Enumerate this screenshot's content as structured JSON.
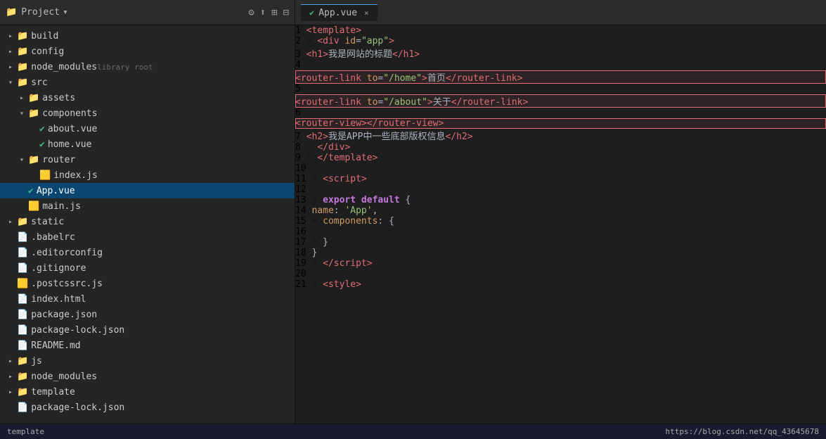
{
  "topbar": {
    "project_label": "Project",
    "dropdown_icon": "▾",
    "tab_label": "App.vue",
    "tab_close": "×"
  },
  "filetree": {
    "items": [
      {
        "id": "build",
        "label": "build",
        "type": "folder",
        "indent": 0,
        "open": false
      },
      {
        "id": "config",
        "label": "config",
        "type": "folder",
        "indent": 0,
        "open": false
      },
      {
        "id": "node_modules",
        "label": "node_modules",
        "suffix": "library root",
        "type": "folder",
        "indent": 0,
        "open": false
      },
      {
        "id": "src",
        "label": "src",
        "type": "folder",
        "indent": 0,
        "open": true
      },
      {
        "id": "assets",
        "label": "assets",
        "type": "folder",
        "indent": 1,
        "open": false
      },
      {
        "id": "components",
        "label": "components",
        "type": "folder",
        "indent": 1,
        "open": true
      },
      {
        "id": "about_vue",
        "label": "about.vue",
        "type": "vue",
        "indent": 2,
        "open": false
      },
      {
        "id": "home_vue",
        "label": "home.vue",
        "type": "vue",
        "indent": 2,
        "open": false
      },
      {
        "id": "router",
        "label": "router",
        "type": "folder",
        "indent": 1,
        "open": true
      },
      {
        "id": "index_js",
        "label": "index.js",
        "type": "js",
        "indent": 2,
        "open": false
      },
      {
        "id": "app_vue",
        "label": "App.vue",
        "type": "vue",
        "indent": 1,
        "open": false,
        "active": true
      },
      {
        "id": "main_js",
        "label": "main.js",
        "type": "js",
        "indent": 1,
        "open": false
      },
      {
        "id": "static",
        "label": "static",
        "type": "folder",
        "indent": 0,
        "open": false
      },
      {
        "id": "babelrc",
        "label": ".babelrc",
        "type": "config",
        "indent": 0
      },
      {
        "id": "editorconfig",
        "label": ".editorconfig",
        "type": "config",
        "indent": 0
      },
      {
        "id": "gitignore",
        "label": ".gitignore",
        "type": "config",
        "indent": 0
      },
      {
        "id": "postcssrc",
        "label": ".postcssrc.js",
        "type": "js2",
        "indent": 0
      },
      {
        "id": "index_html",
        "label": "index.html",
        "type": "html",
        "indent": 0
      },
      {
        "id": "package_json",
        "label": "package.json",
        "type": "json",
        "indent": 0
      },
      {
        "id": "package_lock",
        "label": "package-lock.json",
        "type": "json",
        "indent": 0
      },
      {
        "id": "readme",
        "label": "README.md",
        "type": "md",
        "indent": 0
      },
      {
        "id": "js_folder",
        "label": "js",
        "type": "folder",
        "indent": 0,
        "open": false
      },
      {
        "id": "node_modules2",
        "label": "node_modules",
        "type": "folder",
        "indent": 0,
        "open": false
      },
      {
        "id": "template_folder",
        "label": "template",
        "type": "folder",
        "indent": 0,
        "open": false
      },
      {
        "id": "package_lock2",
        "label": "package-lock.json",
        "type": "json",
        "indent": 0
      }
    ]
  },
  "code": {
    "lines": [
      {
        "num": 1,
        "gutter": "",
        "content_html": "<span class='tag'>&lt;template&gt;</span>"
      },
      {
        "num": 2,
        "gutter": "◦",
        "content_html": "  <span class='tag'>&lt;div</span> <span class='attr'>id</span><span class='punct'>=</span><span class='val'>\"app\"</span><span class='tag'>&gt;</span>"
      },
      {
        "num": 3,
        "gutter": "",
        "content_html": "      <span class='tag'>&lt;h1&gt;</span><span class='chinese'>我是网站的标题</span><span class='tag'>&lt;/h1&gt;</span>"
      },
      {
        "num": 4,
        "gutter": "",
        "content_html": "      <span class='tag'>&lt;router-link</span> <span class='attr'>to</span><span class='punct'>=</span><span class='val'>\"/home\"</span><span class='tag'>&gt;</span><span class='chinese'>首页</span><span class='tag'>&lt;/router-link&gt;</span>",
        "highlight": true
      },
      {
        "num": 5,
        "gutter": "",
        "content_html": "      <span class='tag'>&lt;router-link</span> <span class='attr'>to</span><span class='punct'>=</span><span class='val'>\"/about\"</span><span class='tag'>&gt;</span><span class='chinese'>关于</span><span class='tag'>&lt;/router-link&gt;</span>",
        "highlight": true
      },
      {
        "num": 6,
        "gutter": "",
        "content_html": "      <span class='tag'>&lt;router-view&gt;&lt;/router-view&gt;</span>",
        "highlight2": true
      },
      {
        "num": 7,
        "gutter": "",
        "content_html": "      <span class='tag'>&lt;h2&gt;</span><span class='chinese'>我是APP中一些底部版权信息</span><span class='tag'>&lt;/h2&gt;</span>"
      },
      {
        "num": 8,
        "gutter": "◦",
        "content_html": "  <span class='tag'>&lt;/div&gt;</span>"
      },
      {
        "num": 9,
        "gutter": "◦",
        "content_html": "<span class='tag'>&lt;/template&gt;</span>"
      },
      {
        "num": 10,
        "gutter": "",
        "content_html": ""
      },
      {
        "num": 11,
        "gutter": "◦",
        "content_html": "<span class='tag'>&lt;script&gt;</span>"
      },
      {
        "num": 12,
        "gutter": "",
        "content_html": ""
      },
      {
        "num": 13,
        "gutter": "◦",
        "content_html": "<span class='kw-bold'>export default</span> <span class='punct'>{</span>"
      },
      {
        "num": 14,
        "gutter": "",
        "content_html": "  <span class='prop'>name</span><span class='punct'>:</span> <span class='str'>'App'</span><span class='punct'>,</span>"
      },
      {
        "num": 15,
        "gutter": "◦",
        "content_html": "  <span class='prop'>components</span><span class='punct'>:</span> <span class='punct'>{</span>"
      },
      {
        "num": 16,
        "gutter": "",
        "content_html": ""
      },
      {
        "num": 17,
        "gutter": "◦",
        "content_html": "  <span class='punct'>}</span>"
      },
      {
        "num": 18,
        "gutter": "",
        "content_html": "<span class='punct'>}</span>"
      },
      {
        "num": 19,
        "gutter": "◦",
        "content_html": "<span class='tag'>&lt;/script&gt;</span>"
      },
      {
        "num": 20,
        "gutter": "",
        "content_html": ""
      },
      {
        "num": 21,
        "gutter": "◦",
        "content_html": "<span class='tag'>&lt;style&gt;</span>"
      }
    ]
  },
  "bottombar": {
    "template_text": "template",
    "url": "https://blog.csdn.net/qq_43645678"
  }
}
